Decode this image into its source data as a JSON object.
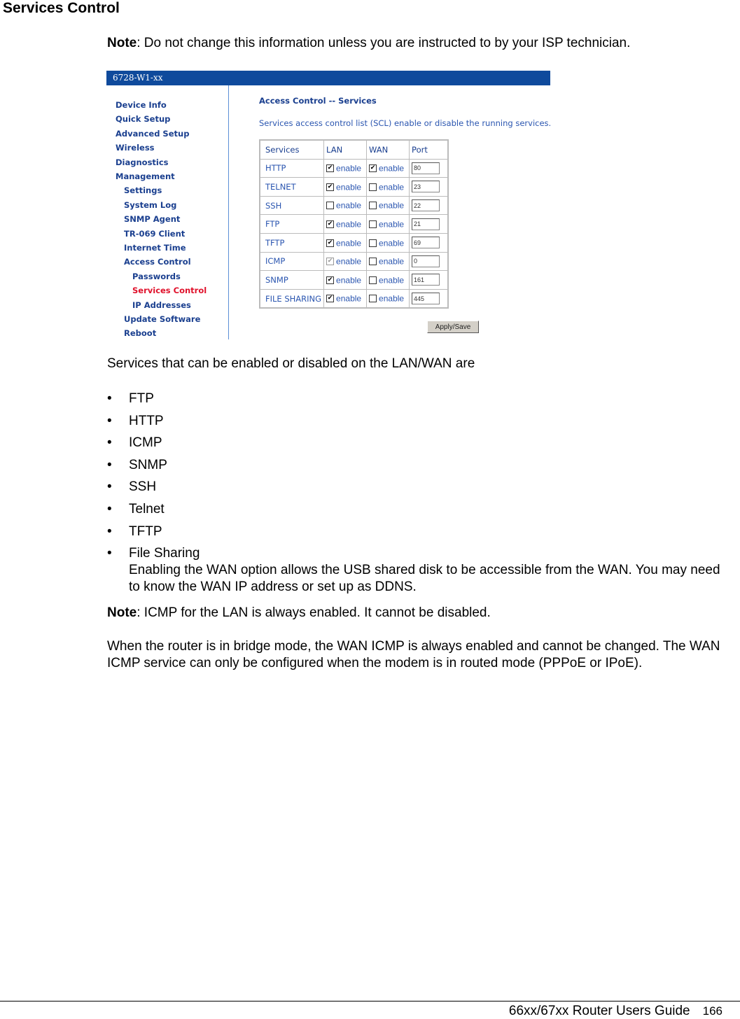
{
  "page": {
    "title": "Services Control",
    "note1": {
      "label": "Note",
      "text": ": Do not change this information unless you are instructed to by your ISP technician."
    },
    "intro": "Services that can be enabled or disabled on the LAN/WAN are",
    "bullets": [
      "FTP",
      "HTTP",
      "ICMP",
      "SNMP",
      "SSH",
      "Telnet",
      "TFTP",
      "File Sharing"
    ],
    "file_sharing_desc": "Enabling the WAN option allows the USB shared disk to be accessible from the WAN. You may need to know the WAN IP address or set up as DDNS.",
    "note2": {
      "label": "Note",
      "text": ": ICMP for the LAN is always enabled.  It cannot be disabled."
    },
    "paragraph": "When the router is in bridge mode, the WAN ICMP is always enabled and cannot be changed. The WAN ICMP service can only be configured when the modem is in routed mode (PPPoE or IPoE).",
    "footer": {
      "guide": "66xx/67xx Router Users Guide",
      "page_number": "166"
    }
  },
  "router_ui": {
    "model": "6728-W1-xx",
    "colors": {
      "header_bg": "#0f4a9c",
      "nav_text": "#1a3f8f",
      "nav_active": "#e0112b",
      "body_text": "#2b56b0"
    },
    "nav": [
      {
        "label": "Device Info",
        "level": 0
      },
      {
        "label": "Quick Setup",
        "level": 0
      },
      {
        "label": "Advanced Setup",
        "level": 0
      },
      {
        "label": "Wireless",
        "level": 0
      },
      {
        "label": "Diagnostics",
        "level": 0
      },
      {
        "label": "Management",
        "level": 0
      },
      {
        "label": "Settings",
        "level": 1
      },
      {
        "label": "System Log",
        "level": 1
      },
      {
        "label": "SNMP Agent",
        "level": 1
      },
      {
        "label": "TR-069 Client",
        "level": 1
      },
      {
        "label": "Internet Time",
        "level": 1
      },
      {
        "label": "Access Control",
        "level": 1
      },
      {
        "label": "Passwords",
        "level": 2
      },
      {
        "label": "Services Control",
        "level": 2,
        "active": true
      },
      {
        "label": "IP Addresses",
        "level": 2
      },
      {
        "label": "Update Software",
        "level": 1
      },
      {
        "label": "Reboot",
        "level": 1
      }
    ],
    "section_title": "Access Control -- Services",
    "description": "Services access control list (SCL) enable or disable the running services.",
    "table": {
      "headers": [
        "Services",
        "LAN",
        "WAN",
        "Port"
      ],
      "enable_label": "enable",
      "rows": [
        {
          "service": "HTTP",
          "lan": true,
          "wan": true,
          "port": "80"
        },
        {
          "service": "TELNET",
          "lan": true,
          "wan": false,
          "port": "23"
        },
        {
          "service": "SSH",
          "lan": false,
          "wan": false,
          "port": "22"
        },
        {
          "service": "FTP",
          "lan": true,
          "wan": false,
          "port": "21"
        },
        {
          "service": "TFTP",
          "lan": true,
          "wan": false,
          "port": "69"
        },
        {
          "service": "ICMP",
          "lan": true,
          "lan_disabled": true,
          "wan": false,
          "port": "0"
        },
        {
          "service": "SNMP",
          "lan": true,
          "wan": false,
          "port": "161"
        },
        {
          "service": "FILE SHARING",
          "lan": true,
          "wan": false,
          "port": "445"
        }
      ]
    },
    "apply_label": "Apply/Save"
  }
}
